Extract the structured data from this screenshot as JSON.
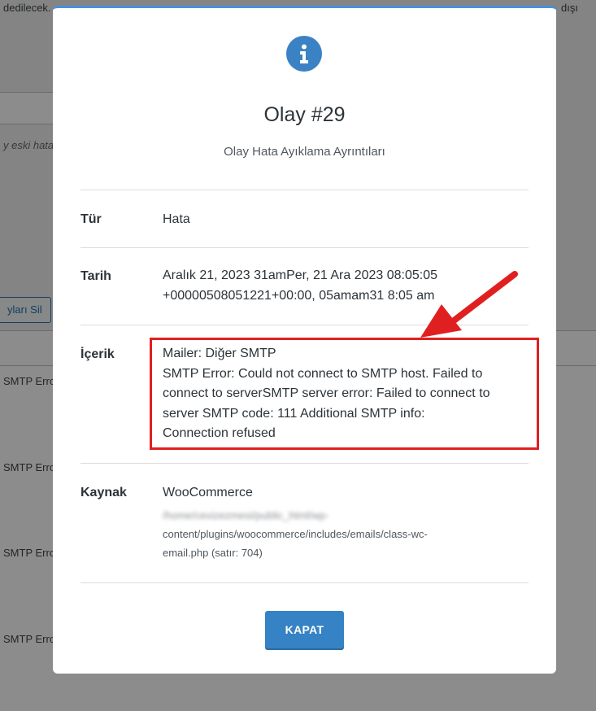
{
  "background": {
    "top_text_left": "dedilecek.",
    "top_text_right": "dışı",
    "italic_text": "y eski hata",
    "delete_button_label": "yları Sil",
    "rows": [
      "SMTP Erro",
      "SMTP Erro",
      "SMTP Erro",
      "SMTP Erro"
    ]
  },
  "modal": {
    "icon": "info-icon",
    "title": "Olay #29",
    "subtitle": "Olay Hata Ayıklama Ayrıntıları",
    "fields": {
      "type": {
        "label": "Tür",
        "value": "Hata"
      },
      "date": {
        "label": "Tarih",
        "value_line1": "Aralık 21, 2023 31amPer, 21 Ara 2023 08:05:05",
        "value_line2": "+00000508051221+00:00, 05amam31 8:05 am"
      },
      "content": {
        "label": "İçerik",
        "lines": [
          "Mailer: Diğer SMTP",
          "SMTP Error: Could not connect to SMTP host. Failed to",
          "connect to serverSMTP server error: Failed to connect to",
          "server SMTP code: 111 Additional SMTP info:",
          "Connection refused"
        ]
      },
      "source": {
        "label": "Kaynak",
        "value": "WooCommerce",
        "path_blurred": "/home/cevizezmesi/public_html/wp-",
        "path_line2": "content/plugins/woocommerce/includes/emails/class-wc-",
        "path_line3": "email.php (satır: 704)"
      }
    },
    "close_label": "KAPAT"
  },
  "annotation": {
    "color": "#e02020"
  },
  "colors": {
    "accent": "#3582c4",
    "highlight": "#e02020"
  }
}
